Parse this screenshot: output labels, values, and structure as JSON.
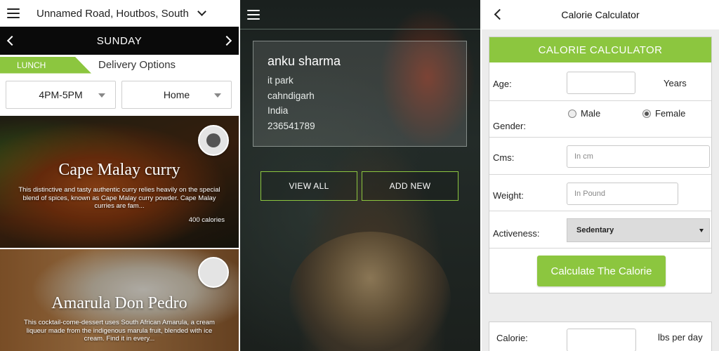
{
  "menu_panel": {
    "location": "Unnamed Road, Houtbos, South",
    "day": "SUNDAY",
    "meal_tag": "LUNCH",
    "delivery_label": "Delivery Options",
    "time_select": "4PM-5PM",
    "place_select": "Home",
    "items": [
      {
        "title": "Cape Malay curry",
        "description": "This distinctive and tasty authentic curry relies heavily on the special blend of spices, known as Cape Malay curry powder. Cape Malay curries are fam...",
        "calories": "400 calories",
        "selected": true
      },
      {
        "title": "Amarula Don Pedro",
        "description": "This cocktail-come-dessert uses South African Amarula, a cream liqueur made from the indigenous marula fruit, blended with ice cream. Find it in every...",
        "selected": false
      }
    ]
  },
  "address_panel": {
    "address": {
      "name": "anku sharma",
      "line1": "it park",
      "line2": "cahndigarh",
      "line3": "India",
      "line4": "236541789"
    },
    "view_all_label": "VIEW ALL",
    "add_new_label": "ADD NEW"
  },
  "calc_panel": {
    "title": "Calorie Calculator",
    "card_header": "CALORIE CALCULATOR",
    "age_label": "Age:",
    "age_value": "",
    "years_label": "Years",
    "gender_label": "Gender:",
    "male_label": "Male",
    "female_label": "Female",
    "gender_selected": "Female",
    "cms_label": "Cms:",
    "cms_placeholder": "In cm",
    "weight_label": "Weight:",
    "weight_placeholder": "In Pound",
    "activeness_label": "Activeness:",
    "activeness_value": "Sedentary",
    "calculate_label": "Calculate The Calorie",
    "calorie_label": "Calorie:",
    "calorie_value": "",
    "calorie_unit": "lbs per day"
  },
  "colors": {
    "accent_green": "#8cc63f",
    "day_bar": "#0a0a0a"
  }
}
